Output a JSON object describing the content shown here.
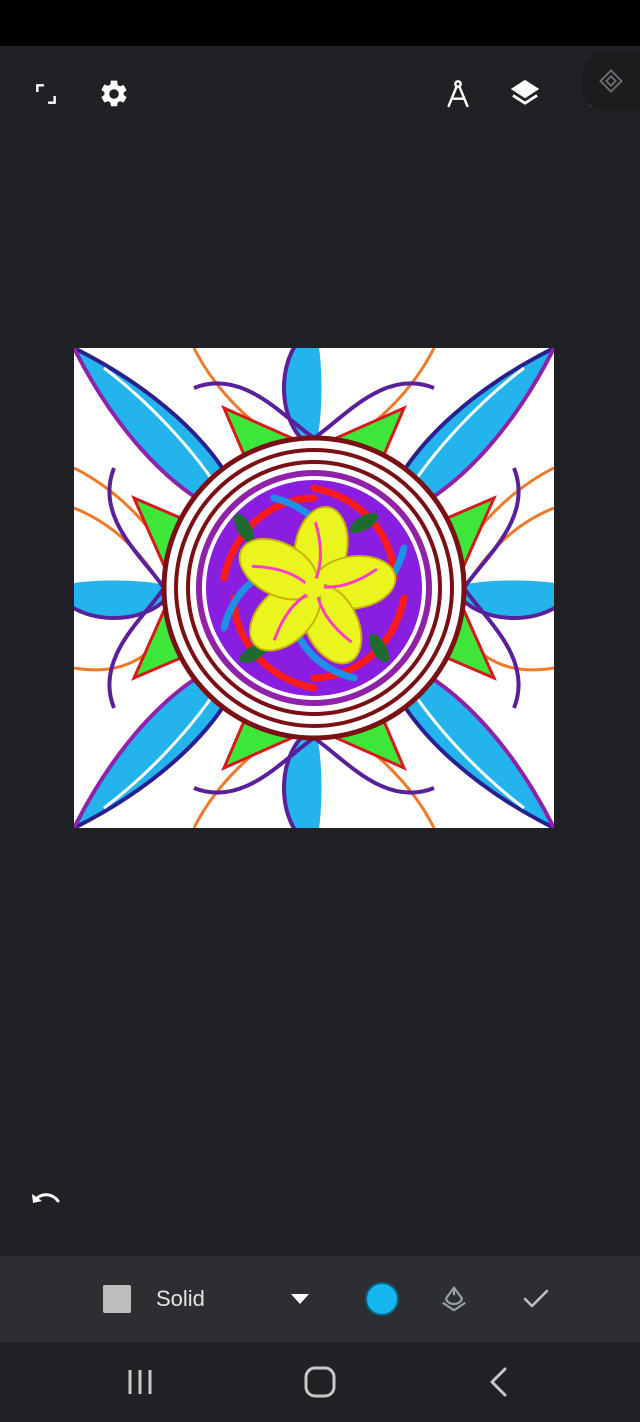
{
  "app": {
    "toolbar": {
      "items": [
        {
          "name": "fullscreen",
          "icon": "fullscreen-icon"
        },
        {
          "name": "settings",
          "icon": "gear-icon"
        },
        {
          "name": "compass",
          "icon": "compass-icon"
        },
        {
          "name": "layers",
          "icon": "layers-icon"
        },
        {
          "name": "more",
          "icon": "more-vert-icon"
        }
      ],
      "floating_icon": "symmetry-icon"
    },
    "canvas": {
      "description_icon": "mandala-artwork",
      "background_color": "#ffffff"
    },
    "undo_icon": "undo-icon",
    "bottom_toolbar": {
      "fill_swatch_color": "#bdbdbd",
      "fill_type_label": "Solid",
      "dropdown_icon": "caret-down-icon",
      "current_color": "#13b6ee",
      "fill_icon": "paint-bucket-icon",
      "confirm_icon": "check-icon"
    },
    "nav_bar": {
      "items": [
        "recent-apps-icon",
        "home-icon",
        "back-icon"
      ]
    }
  }
}
